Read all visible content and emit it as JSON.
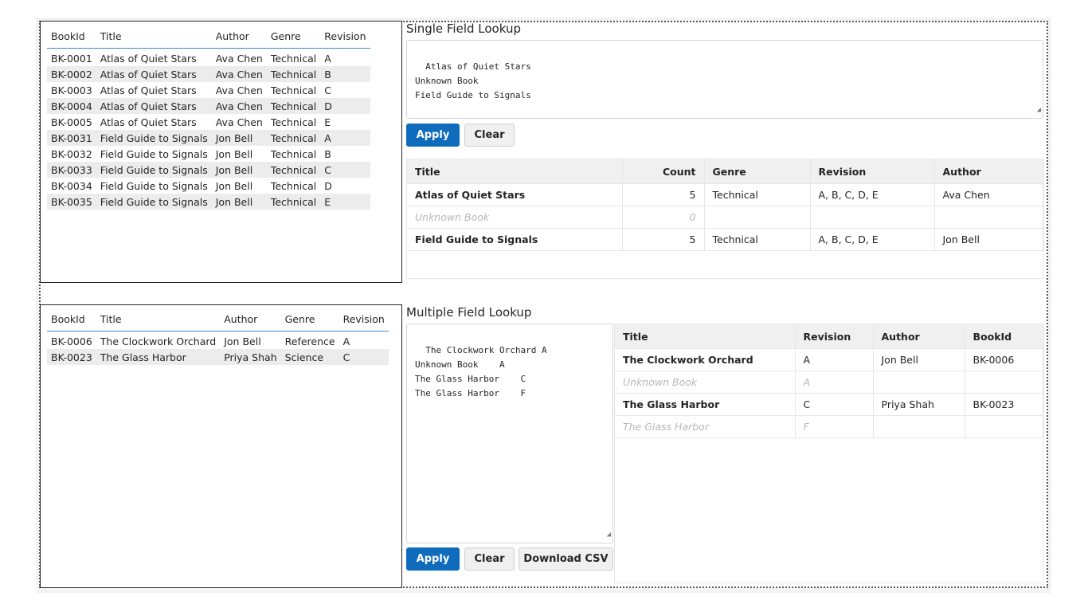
{
  "table1": {
    "headers": [
      "BookId",
      "Title",
      "Author",
      "Genre",
      "Revision"
    ],
    "rows": [
      [
        "BK-0001",
        "Atlas of Quiet Stars",
        "Ava Chen",
        "Technical",
        "A"
      ],
      [
        "BK-0002",
        "Atlas of Quiet Stars",
        "Ava Chen",
        "Technical",
        "B"
      ],
      [
        "BK-0003",
        "Atlas of Quiet Stars",
        "Ava Chen",
        "Technical",
        "C"
      ],
      [
        "BK-0004",
        "Atlas of Quiet Stars",
        "Ava Chen",
        "Technical",
        "D"
      ],
      [
        "BK-0005",
        "Atlas of Quiet Stars",
        "Ava Chen",
        "Technical",
        "E"
      ],
      [
        "BK-0031",
        "Field Guide to Signals",
        "Jon Bell",
        "Technical",
        "A"
      ],
      [
        "BK-0032",
        "Field Guide to Signals",
        "Jon Bell",
        "Technical",
        "B"
      ],
      [
        "BK-0033",
        "Field Guide to Signals",
        "Jon Bell",
        "Technical",
        "C"
      ],
      [
        "BK-0034",
        "Field Guide to Signals",
        "Jon Bell",
        "Technical",
        "D"
      ],
      [
        "BK-0035",
        "Field Guide to Signals",
        "Jon Bell",
        "Technical",
        "E"
      ]
    ]
  },
  "table2": {
    "headers": [
      "BookId",
      "Title",
      "Author",
      "Genre",
      "Revision"
    ],
    "rows": [
      [
        "BK-0006",
        "The Clockwork Orchard",
        "Jon Bell",
        "Reference",
        "A"
      ],
      [
        "BK-0023",
        "The Glass Harbor",
        "Priya Shah",
        "Science",
        "C"
      ]
    ]
  },
  "single": {
    "title": "Single Field Lookup",
    "input": "Atlas of Quiet Stars\nUnknown Book\nField Guide to Signals",
    "apply": "Apply",
    "clear": "Clear",
    "headers": [
      "Title",
      "Count",
      "Genre",
      "Revision",
      "Author"
    ],
    "rows": [
      {
        "title": "Atlas of Quiet Stars",
        "count": "5",
        "genre": "Technical",
        "revision": "A, B, C, D, E",
        "author": "Ava Chen",
        "missing": false
      },
      {
        "title": "Unknown Book",
        "count": "0",
        "genre": "",
        "revision": "",
        "author": "",
        "missing": true
      },
      {
        "title": "Field Guide to Signals",
        "count": "5",
        "genre": "Technical",
        "revision": "A, B, C, D, E",
        "author": "Jon Bell",
        "missing": false
      }
    ]
  },
  "multi": {
    "title": "Multiple Field Lookup",
    "input": "The Clockwork Orchard\tA\nUnknown Book\tA\nThe Glass Harbor\tC\nThe Glass Harbor\tF",
    "apply": "Apply",
    "clear": "Clear",
    "download": "Download CSV",
    "headers": [
      "Title",
      "Revision",
      "Author",
      "BookId"
    ],
    "rows": [
      {
        "title": "The Clockwork Orchard",
        "revision": "A",
        "author": "Jon Bell",
        "bookid": "BK-0006",
        "missing": false
      },
      {
        "title": "Unknown Book",
        "revision": "A",
        "author": "",
        "bookid": "",
        "missing": true
      },
      {
        "title": "The Glass Harbor",
        "revision": "C",
        "author": "Priya Shah",
        "bookid": "BK-0023",
        "missing": false
      },
      {
        "title": "The Glass Harbor",
        "revision": "F",
        "author": "",
        "bookid": "",
        "missing": true
      }
    ]
  },
  "colors": {
    "accent": "#0f6cbd",
    "header_line": "#3a86d8",
    "alt_row": "#ececec"
  }
}
